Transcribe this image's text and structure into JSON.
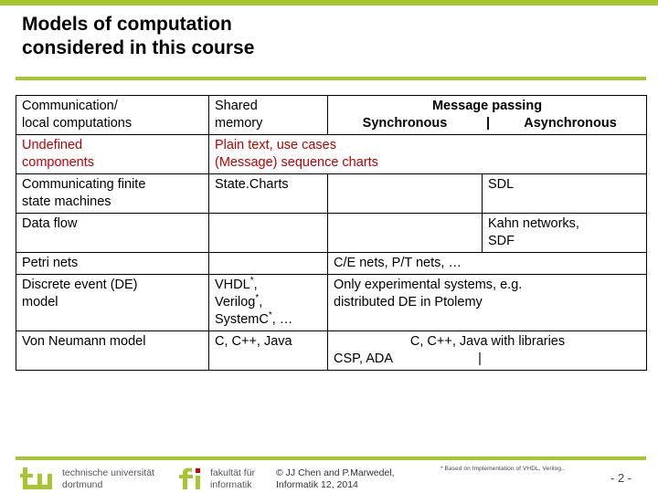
{
  "theme": {
    "green": "#a5c62e",
    "red": "#c00000",
    "text": "#000000"
  },
  "slide": {
    "title_line1": "Models of computation",
    "title_line2": "considered in this course",
    "page_number": "- 2 -"
  },
  "table": {
    "header": {
      "col1": "Communication/ local computations",
      "col1_line1": "Communication/",
      "col1_line2": "local computations",
      "col2_line1": "Shared",
      "col2_line2": "memory",
      "message_passing": "Message passing",
      "synchronous": "Synchronous",
      "divider": "|",
      "asynchronous": "Asynchronous"
    },
    "rows": [
      {
        "label_line1": "Undefined",
        "label_line2": "components",
        "label_color": "#c00000",
        "span_line1": "Plain text, use cases",
        "span_line2": "(Message) sequence charts",
        "span_color": "#c00000"
      },
      {
        "label_line1": "Communicating finite",
        "label_line2": "state machines",
        "shared_memory": "State.Charts",
        "synchronous": "",
        "asynchronous": "SDL"
      },
      {
        "label_line1": "Data flow",
        "label_line2": "",
        "shared_memory": "",
        "synchronous": "",
        "asynchronous_line1": "Kahn networks,",
        "asynchronous_line2": "SDF"
      },
      {
        "label_line1": "Petri nets",
        "shared_memory": "",
        "span": "C/E nets, P/T nets, …"
      },
      {
        "label_line1": "Discrete event (DE)",
        "label_line2": "model",
        "sm_line1": "VHDL",
        "sm_line2": "Verilog",
        "sm_line3": "SystemC",
        "sm_suffix": ", …",
        "span_line1": "Only experimental systems, e.g.",
        "span_line2": "distributed DE in Ptolemy"
      },
      {
        "label_line1": "Von Neumann model",
        "shared_memory": "C, C++, Java",
        "span_line1": "C, C++, Java with libraries",
        "span_line2": "CSP, ADA",
        "span_line2_bar": "|"
      }
    ]
  },
  "footer": {
    "tu_line1": "technische universität",
    "tu_line2": "dortmund",
    "fi_line1": "fakultät für",
    "fi_line2": "informatik",
    "copy_line1": "© JJ Chen and  P.Marwedel,",
    "copy_line2": "Informatik 12,  2014",
    "footnote": "* Based on Implementation of VHDL, Verilog.."
  }
}
